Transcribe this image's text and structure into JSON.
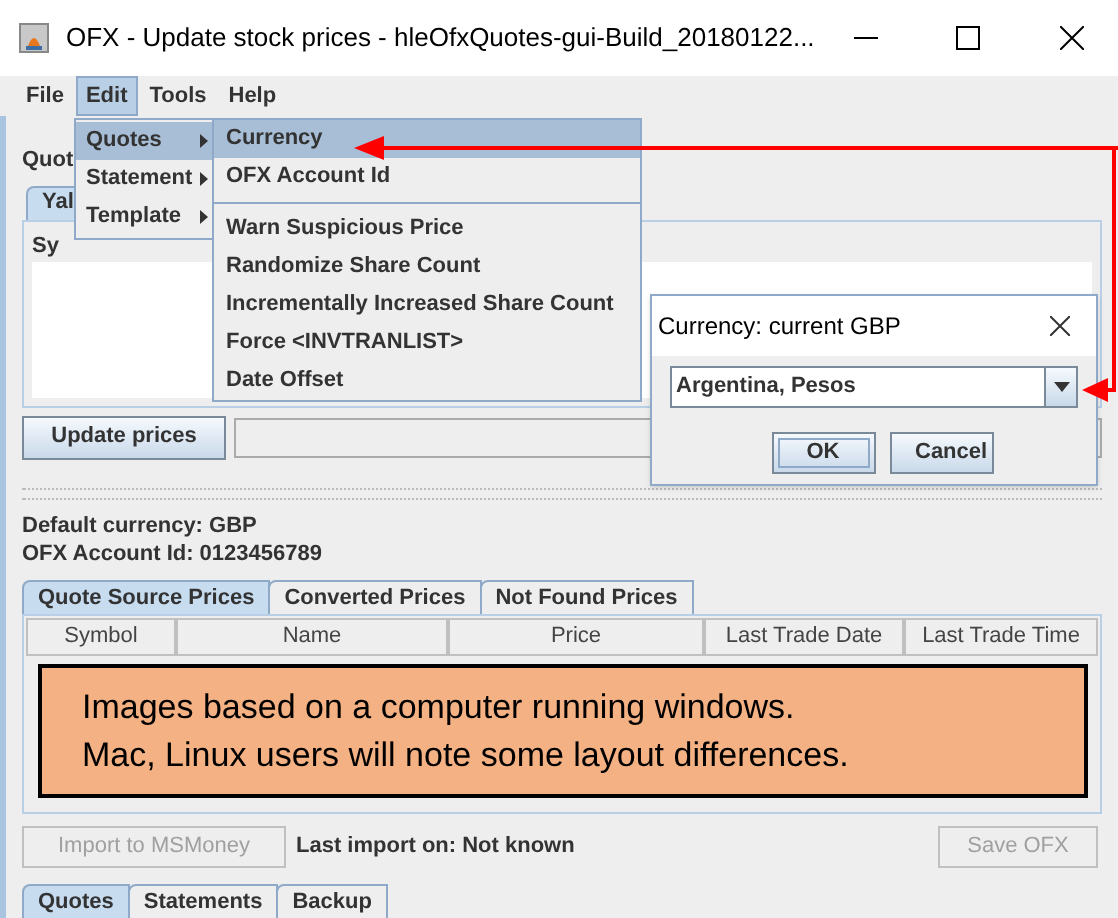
{
  "window": {
    "title": "OFX - Update stock prices - hleOfxQuotes-gui-Build_20180122..."
  },
  "menu_bar": [
    {
      "label": "File",
      "selected": false
    },
    {
      "label": "Edit",
      "selected": true
    },
    {
      "label": "Tools",
      "selected": false
    },
    {
      "label": "Help",
      "selected": false
    }
  ],
  "edit_menu": [
    {
      "label": "Quotes",
      "selected": true
    },
    {
      "label": "Statement",
      "selected": false
    },
    {
      "label": "Template",
      "selected": false
    }
  ],
  "quotes_submenu": [
    {
      "kind": "item",
      "label": "Currency",
      "selected": true
    },
    {
      "kind": "item",
      "label": "OFX Account Id",
      "selected": false
    },
    {
      "kind": "separator"
    },
    {
      "kind": "item",
      "label": "Warn Suspicious Price",
      "selected": false
    },
    {
      "kind": "item",
      "label": "Randomize Share Count",
      "selected": false
    },
    {
      "kind": "item",
      "label": "Incrementally Increased Share Count",
      "selected": false
    },
    {
      "kind": "item",
      "label": "Force <INVTRANLIST>",
      "selected": false
    },
    {
      "kind": "item",
      "label": "Date Offset",
      "selected": false
    }
  ],
  "top_panel": {
    "heading": "Quot",
    "tabs": [
      {
        "label": "Yal",
        "selected": true
      }
    ],
    "group_label": "Sy",
    "update_button": "Update prices"
  },
  "progress": {
    "level": 0
  },
  "info": [
    "Default currency: GBP",
    "OFX Account Id: 0123456789"
  ],
  "result_tabs": [
    {
      "label": "Quote Source Prices",
      "selected": true
    },
    {
      "label": "Converted Prices",
      "selected": false
    },
    {
      "label": "Not Found Prices",
      "selected": false
    }
  ],
  "table": {
    "columns": [
      "Symbol",
      "Name",
      "Price",
      "Last Trade Date",
      "Last Trade Time"
    ]
  },
  "note_lines": [
    "Images based on a computer running windows.",
    "Mac, Linux users will note some layout differences."
  ],
  "import_button": {
    "label": "Import to MSMoney",
    "disabled": true
  },
  "last_import": "Last import on: Not known",
  "save_button": {
    "label": "Save OFX",
    "disabled": true
  },
  "bottom_tabs": [
    {
      "label": "Quotes",
      "selected": true
    },
    {
      "label": "Statements",
      "selected": false
    },
    {
      "label": "Backup",
      "selected": false
    }
  ],
  "dialog": {
    "title": "Currency: current GBP",
    "combo_value": "Argentina, Pesos",
    "buttons": [
      {
        "label": "OK",
        "focused": true
      },
      {
        "label": "Cancel",
        "focused": false
      }
    ]
  }
}
